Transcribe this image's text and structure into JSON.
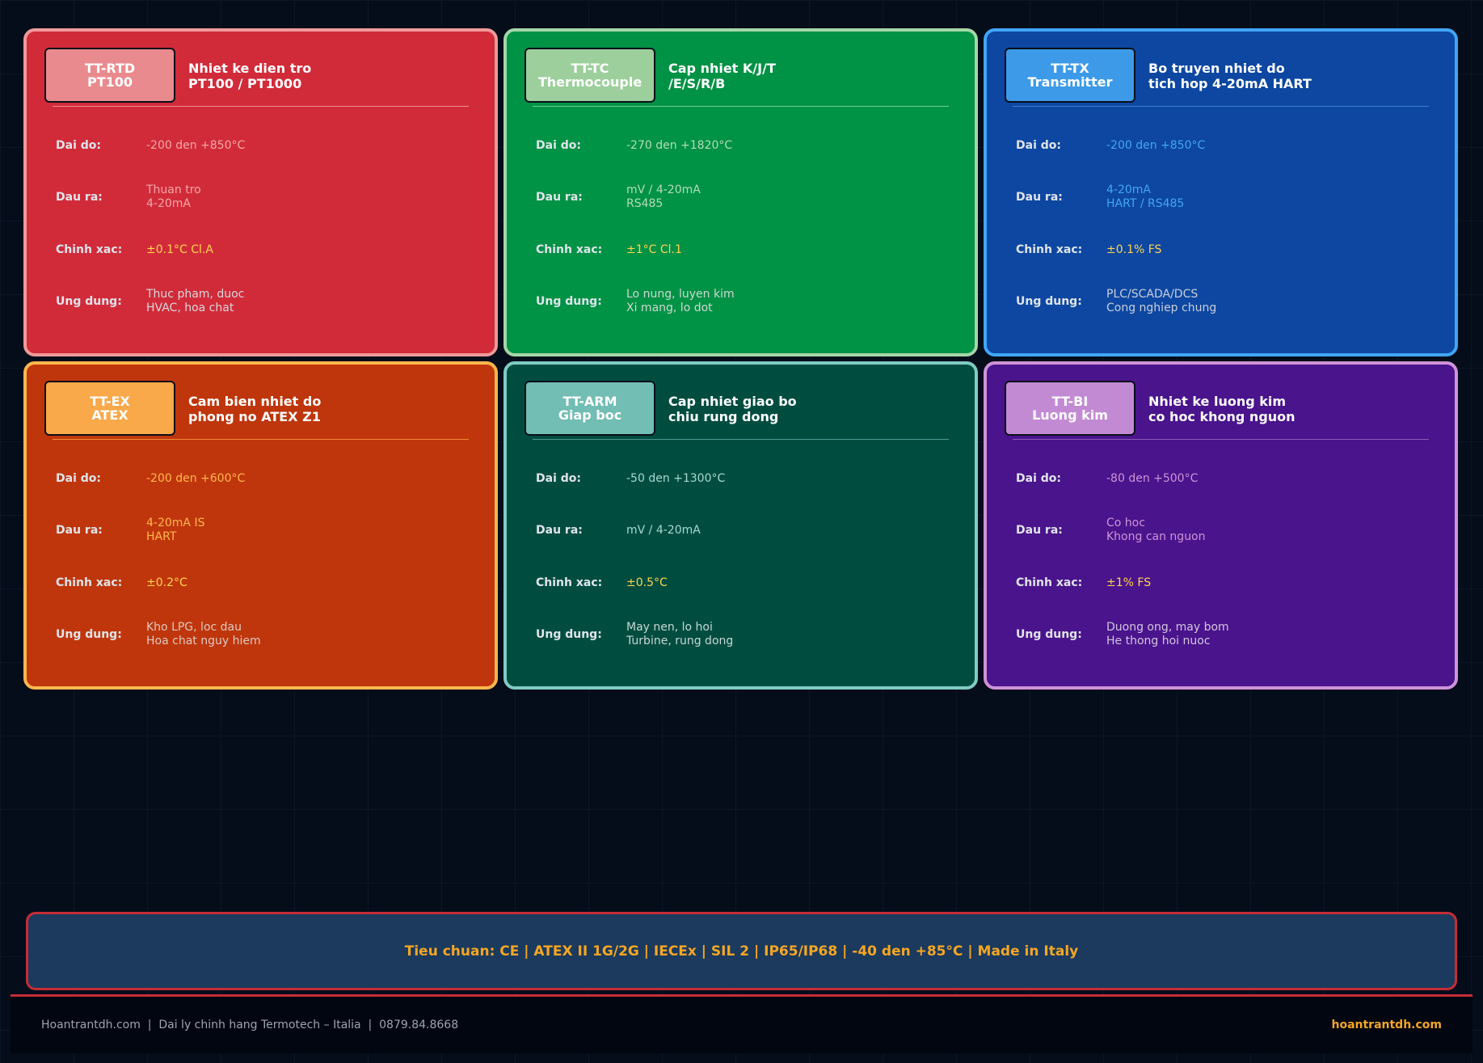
{
  "cards": [
    {
      "code_line1": "TT-RTD",
      "code_line2": "PT100",
      "title_line1": "Nhiet ke dien tro",
      "title_line2": "PT100 / PT1000",
      "range_label": "Dai do:",
      "range_value": "-200 den +850°C",
      "output_label": "Dau ra:",
      "output_value1": "Thuan tro",
      "output_value2": "4-20mA",
      "accuracy_label": "Chinh xac:",
      "accuracy_value": "±0.1°C Cl.A",
      "app_label": "Ung dung:",
      "app_value1": "Thuc pham, duoc",
      "app_value2": "HVAC, hoa chat",
      "colors": {
        "bg": "#d12b3a",
        "border": "#ef9a9a",
        "badge": "#e98b8e",
        "divider": "#f28e95",
        "range": "#f4a7a7",
        "output": "#f4a7a7",
        "accuracy": "#ffd54f",
        "app": "#d9d9d9"
      }
    },
    {
      "code_line1": "TT-TC",
      "code_line2": "Thermocouple",
      "title_line1": "Cap nhiet K/J/T",
      "title_line2": "/E/S/R/B",
      "range_label": "Dai do:",
      "range_value": "-270 den +1820°C",
      "output_label": "Dau ra:",
      "output_value1": "mV / 4-20mA",
      "output_value2": "RS485",
      "accuracy_label": "Chinh xac:",
      "accuracy_value": "±1°C Cl.1",
      "app_label": "Ung dung:",
      "app_value1": "Lo nung, luyen kim",
      "app_value2": "Xi mang, lo dot",
      "colors": {
        "bg": "#009245",
        "border": "#a5d6a7",
        "badge": "#9ccf9c",
        "divider": "#6fcf8e",
        "range": "#b3dcb8",
        "output": "#b3dcb8",
        "accuracy": "#ffd54f",
        "app": "#cfd8cf"
      }
    },
    {
      "code_line1": "TT-TX",
      "code_line2": "Transmitter",
      "title_line1": "Bo truyen nhiet do",
      "title_line2": "tich hop 4-20mA HART",
      "range_label": "Dai do:",
      "range_value": "-200 den +850°C",
      "output_label": "Dau ra:",
      "output_value1": "4-20mA",
      "output_value2": "HART / RS485",
      "accuracy_label": "Chinh xac:",
      "accuracy_value": "±0.1% FS",
      "app_label": "Ung dung:",
      "app_value1": "PLC/SCADA/DCS",
      "app_value2": "Cong nghiep chung",
      "colors": {
        "bg": "#0d47a1",
        "border": "#42a5f5",
        "badge": "#3d9ae8",
        "divider": "#3f7fd0",
        "range": "#42a5f5",
        "output": "#42a5f5",
        "accuracy": "#ffd54f",
        "app": "#c8cfdb"
      }
    },
    {
      "code_line1": "TT-EX",
      "code_line2": "ATEX",
      "title_line1": "Cam bien nhiet do",
      "title_line2": "phong no ATEX Z1",
      "range_label": "Dai do:",
      "range_value": "-200 den +600°C",
      "output_label": "Dau ra:",
      "output_value1": "4-20mA IS",
      "output_value2": "HART",
      "accuracy_label": "Chinh xac:",
      "accuracy_value": "±0.2°C",
      "app_label": "Ung dung:",
      "app_value1": "Kho LPG, loc dau",
      "app_value2": "Hoa chat nguy hiem",
      "colors": {
        "bg": "#bf360c",
        "border": "#ffb74d",
        "badge": "#f9a84a",
        "divider": "#f08a3c",
        "range": "#ffb74d",
        "output": "#ffb74d",
        "accuracy": "#ffd54f",
        "app": "#dcc8bf"
      }
    },
    {
      "code_line1": "TT-ARM",
      "code_line2": "Giap boc",
      "title_line1": "Cap nhiet giao bo",
      "title_line2": "chiu rung dong",
      "range_label": "Dai do:",
      "range_value": "-50 den +1300°C",
      "output_label": "Dau ra:",
      "output_value1": "mV / 4-20mA",
      "output_value2": "",
      "accuracy_label": "Chinh xac:",
      "accuracy_value": "±0.5°C",
      "app_label": "Ung dung:",
      "app_value1": "May nen, lo hoi",
      "app_value2": "Turbine, rung dong",
      "colors": {
        "bg": "#004d40",
        "border": "#80cbc4",
        "badge": "#72bdb4",
        "divider": "#4f9a90",
        "range": "#a8d8d0",
        "output": "#a8d8d0",
        "accuracy": "#ffd54f",
        "app": "#c7d6d3"
      }
    },
    {
      "code_line1": "TT-BI",
      "code_line2": "Luong kim",
      "title_line1": "Nhiet ke luong kim",
      "title_line2": "co hoc khong nguon",
      "range_label": "Dai do:",
      "range_value": "-80 den +500°C",
      "output_label": "Dau ra:",
      "output_value1": "Co hoc",
      "output_value2": "Khong can nguon",
      "accuracy_label": "Chinh xac:",
      "accuracy_value": "±1% FS",
      "app_label": "Ung dung:",
      "app_value1": "Duong ong, may bom",
      "app_value2": "He thong hoi nuoc",
      "colors": {
        "bg": "#4a148c",
        "border": "#ce93d8",
        "badge": "#c38ad4",
        "divider": "#8a5cb8",
        "range": "#ce93d8",
        "output": "#ce93d8",
        "accuracy": "#ffd54f",
        "app": "#d3c6df"
      }
    }
  ],
  "footer": {
    "standards": "Tieu chuan: CE | ATEX II 1G/2G | IECEx | SIL 2 | IP65/IP68 | -40 den +85°C | Made in Italy",
    "contact": "Hoantrantdh.com  |  Dai ly chinh hang Termotech – Italia  |  0879.84.8668",
    "site": "hoantrantdh.com"
  }
}
